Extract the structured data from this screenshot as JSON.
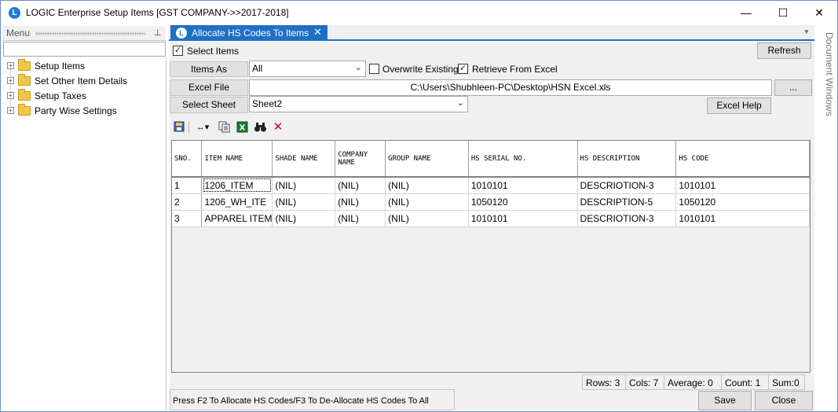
{
  "window": {
    "title": "LOGIC Enterprise Setup Items  [GST COMPANY->>2017-2018]",
    "icon": "logic-app-icon",
    "controls": {
      "minimize": "—",
      "maximize": "☐",
      "close": "✕"
    }
  },
  "menu": {
    "title": "Menu",
    "pin": "⊥",
    "items": [
      {
        "label": "Setup Items"
      },
      {
        "label": "Set Other Item Details"
      },
      {
        "label": "Setup Taxes"
      },
      {
        "label": "Party Wise Settings"
      }
    ]
  },
  "tab": {
    "label": "Allocate HS Codes To Items",
    "close": "✕"
  },
  "side_panel": {
    "label": "Document Windows"
  },
  "form": {
    "select_items_label": "Select Items",
    "select_items_checked": true,
    "refresh_label": "Refresh",
    "items_as_label": "Items As",
    "items_as_value": "All",
    "overwrite_label": "Overwrite Existing",
    "overwrite_checked": false,
    "retrieve_label": "Retrieve From Excel",
    "retrieve_checked": true,
    "excel_file_label": "Excel File",
    "excel_file_value": "C:\\Users\\Shubhleen-PC\\Desktop\\HSN Excel.xls",
    "browse_label": "...",
    "select_sheet_label": "Select Sheet",
    "select_sheet_value": "Sheet2",
    "excel_help_label": "Excel Help"
  },
  "toolbar": {
    "icons": [
      "save-layout-icon",
      "column-width-icon",
      "copy-icon",
      "excel-export-icon",
      "find-icon",
      "delete-icon"
    ]
  },
  "grid": {
    "columns": [
      "SNO.",
      "ITEM NAME",
      "SHADE NAME",
      "COMPANY NAME",
      "GROUP NAME",
      "HS SERIAL NO.",
      "HS DESCRIPTION",
      "HS CODE"
    ],
    "rows": [
      [
        "1",
        "1206_ITEM",
        "(NIL)",
        "(NIL)",
        "(NIL)",
        "1010101",
        "DESCRIOTION-3",
        "1010101"
      ],
      [
        "2",
        "1206_WH_ITE",
        "(NIL)",
        "(NIL)",
        "(NIL)",
        "1050120",
        "DESCRIPTION-5",
        "1050120"
      ],
      [
        "3",
        "APPAREL ITEM",
        "(NIL)",
        "(NIL)",
        "(NIL)",
        "1010101",
        "DESCRIOTION-3",
        "1010101"
      ]
    ]
  },
  "status": {
    "rows": "Rows: 3",
    "cols": "Cols: 7",
    "average": "Average: 0",
    "count": "Count: 1",
    "sum": "Sum:0"
  },
  "hint": "Press F2 To Allocate HS Codes/F3 To De-Allocate HS Codes To All",
  "buttons": {
    "save": "Save",
    "close": "Close"
  },
  "colors": {
    "accent": "#1f6fc5",
    "border": "#6b8dc7",
    "folder": "#f2c64b",
    "delete": "#d0021b",
    "excel": "#1e7b34"
  }
}
